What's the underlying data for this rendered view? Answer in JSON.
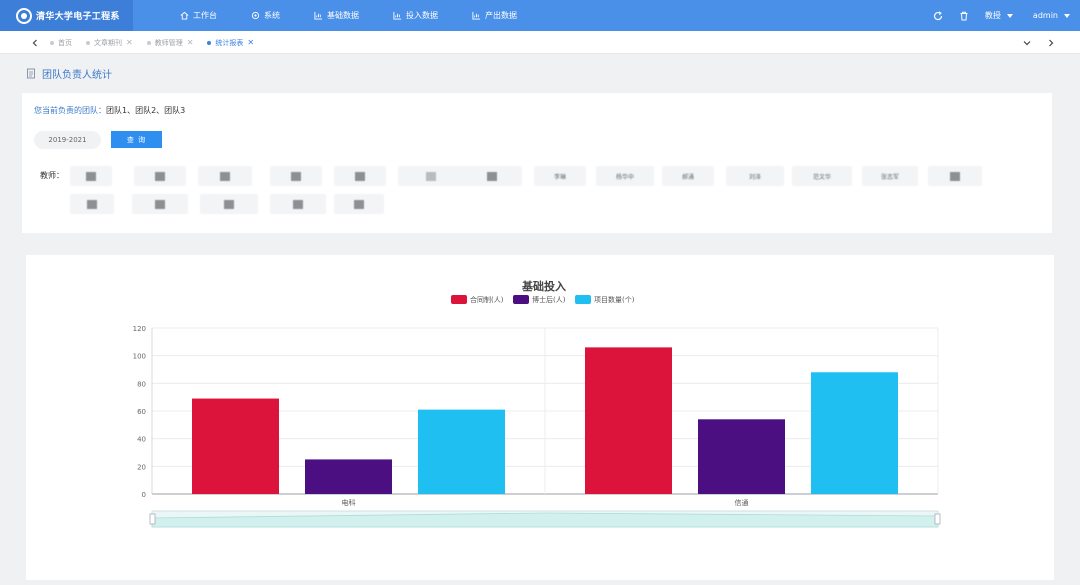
{
  "header": {
    "logo_text": "清华大学电子工程系",
    "nav": [
      {
        "label": "工作台",
        "icon": "home-icon"
      },
      {
        "label": "系统",
        "icon": "gear-icon"
      },
      {
        "label": "基础数据",
        "icon": "chart-icon"
      },
      {
        "label": "投入数据",
        "icon": "chart-icon"
      },
      {
        "label": "产出数据",
        "icon": "chart-icon"
      }
    ],
    "role": "教授",
    "user": "admin"
  },
  "tabs": [
    {
      "label": "首页",
      "active": false
    },
    {
      "label": "文章期刊",
      "active": false
    },
    {
      "label": "教师管理",
      "active": false
    },
    {
      "label": "统计报表",
      "active": true
    }
  ],
  "page": {
    "title": "团队负责人统计",
    "team_label": "您当前负责的团队：",
    "team_value": "团队1、团队2、团队3",
    "year_range": "2019-2021",
    "query_button": "查 询",
    "teacher_label": "教师："
  },
  "teacher_chips": [
    {
      "text": "",
      "blot": true
    },
    {
      "text": "",
      "blot": true
    },
    {
      "text": "",
      "blot": true
    },
    {
      "text": "",
      "blot": true
    },
    {
      "text": "",
      "blot": true
    },
    {
      "text": "",
      "blot": true
    },
    {
      "text": "",
      "blot": true
    },
    {
      "text": "李琳",
      "blot": false
    },
    {
      "text": "杨华中",
      "blot": false
    },
    {
      "text": "郝涌",
      "blot": false
    },
    {
      "text": "刘泽",
      "blot": true
    },
    {
      "text": "范文华",
      "blot": false
    },
    {
      "text": "张志军",
      "blot": false
    },
    {
      "text": "",
      "blot": true
    },
    {
      "text": "",
      "blot": true
    },
    {
      "text": "",
      "blot": true
    },
    {
      "text": "",
      "blot": true
    },
    {
      "text": "",
      "blot": true
    },
    {
      "text": "",
      "blot": true
    }
  ],
  "chart_data": {
    "type": "bar",
    "title": "基础投入",
    "categories": [
      "电科",
      "信通"
    ],
    "series": [
      {
        "name": "合同制(人)",
        "color": "#dc143c",
        "values": [
          69,
          106
        ]
      },
      {
        "name": "博士后(人)",
        "color": "#4b0f82",
        "values": [
          25,
          54
        ]
      },
      {
        "name": "项目数量(个)",
        "color": "#1fbff2",
        "values": [
          61,
          88
        ]
      }
    ],
    "ylim": [
      0,
      120
    ],
    "yticks": [
      0,
      20,
      40,
      60,
      80,
      100,
      120
    ],
    "legend_position": "top-center",
    "grid": true,
    "zoom_slider": true
  }
}
